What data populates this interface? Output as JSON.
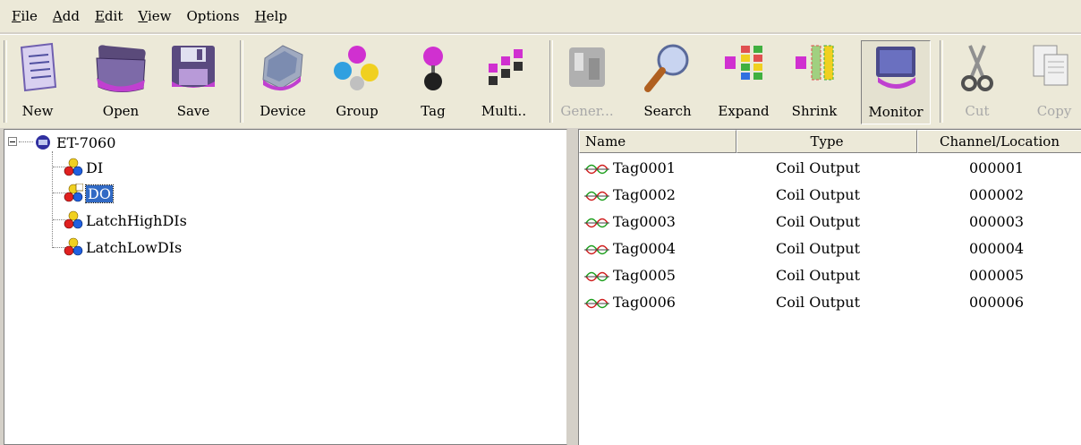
{
  "menu": {
    "items": [
      {
        "mnemonic": "F",
        "rest": "ile"
      },
      {
        "mnemonic": "A",
        "rest": "dd"
      },
      {
        "mnemonic": "E",
        "rest": "dit"
      },
      {
        "mnemonic": "V",
        "rest": "iew"
      },
      {
        "mnemonic": "",
        "rest": "Options"
      },
      {
        "mnemonic": "H",
        "rest": "elp"
      }
    ]
  },
  "toolbar": {
    "new_label": "New",
    "open_label": "Open",
    "save_label": "Save",
    "device_label": "Device",
    "group_label": "Group",
    "tag_label": "Tag",
    "multi_label": "Multi..",
    "gener_label": "Gener...",
    "search_label": "Search",
    "expand_label": "Expand",
    "shrink_label": "Shrink",
    "monitor_label": "Monitor",
    "cut_label": "Cut",
    "copy_label": "Copy"
  },
  "tree": {
    "root": "ET-7060",
    "children": [
      "DI",
      "DO",
      "LatchHighDIs",
      "LatchLowDIs"
    ],
    "selected": "DO"
  },
  "list": {
    "columns": [
      "Name",
      "Type",
      "Channel/Location"
    ],
    "rows": [
      {
        "name": "Tag0001",
        "type": "Coil Output",
        "location": "000001"
      },
      {
        "name": "Tag0002",
        "type": "Coil Output",
        "location": "000002"
      },
      {
        "name": "Tag0003",
        "type": "Coil Output",
        "location": "000003"
      },
      {
        "name": "Tag0004",
        "type": "Coil Output",
        "location": "000004"
      },
      {
        "name": "Tag0005",
        "type": "Coil Output",
        "location": "000005"
      },
      {
        "name": "Tag0006",
        "type": "Coil Output",
        "location": "000006"
      }
    ]
  },
  "colors": {
    "selection": "#316ac5",
    "toolbar_bg": "#ece9d8"
  }
}
